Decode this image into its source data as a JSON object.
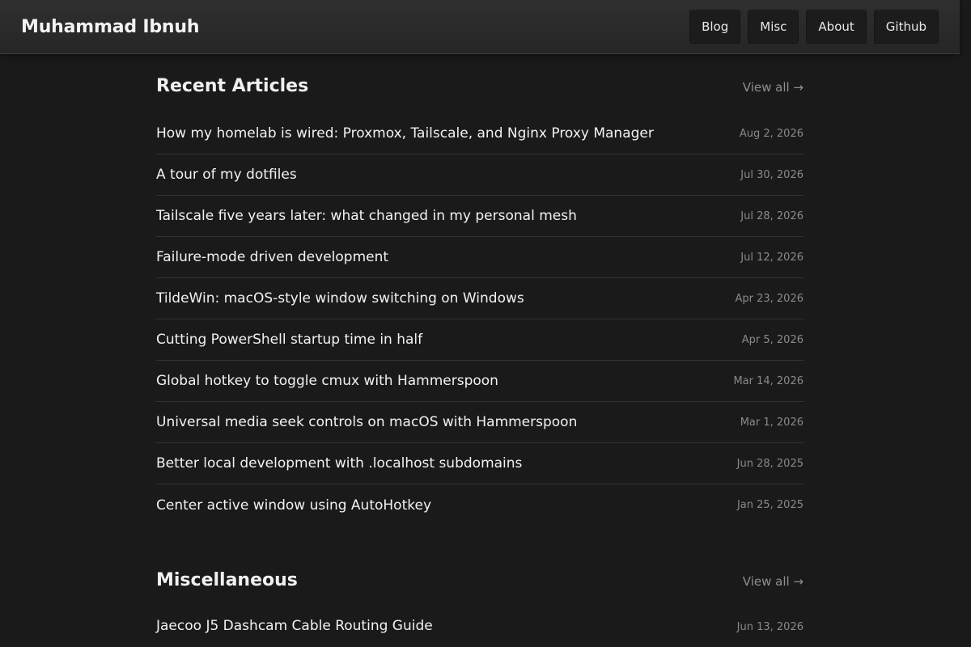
{
  "header": {
    "site_title": "Muhammad Ibnuh",
    "nav": [
      {
        "label": "Blog"
      },
      {
        "label": "Misc"
      },
      {
        "label": "About"
      },
      {
        "label": "Github"
      }
    ]
  },
  "recent": {
    "title": "Recent Articles",
    "view_all": "View all →",
    "articles": [
      {
        "title": "How my homelab is wired: Proxmox, Tailscale, and Nginx Proxy Manager",
        "date": "Aug 2, 2026"
      },
      {
        "title": "A tour of my dotfiles",
        "date": "Jul 30, 2026"
      },
      {
        "title": "Tailscale five years later: what changed in my personal mesh",
        "date": "Jul 28, 2026"
      },
      {
        "title": "Failure-mode driven development",
        "date": "Jul 12, 2026"
      },
      {
        "title": "TildeWin: macOS-style window switching on Windows",
        "date": "Apr 23, 2026"
      },
      {
        "title": "Cutting PowerShell startup time in half",
        "date": "Apr 5, 2026"
      },
      {
        "title": "Global hotkey to toggle cmux with Hammerspoon",
        "date": "Mar 14, 2026"
      },
      {
        "title": "Universal media seek controls on macOS with Hammerspoon",
        "date": "Mar 1, 2026"
      },
      {
        "title": "Better local development with .localhost subdomains",
        "date": "Jun 28, 2025"
      },
      {
        "title": "Center active window using AutoHotkey",
        "date": "Jan 25, 2025"
      }
    ]
  },
  "misc": {
    "title": "Miscellaneous",
    "view_all": "View all →",
    "items": [
      {
        "title": "Jaecoo J5 Dashcam Cable Routing Guide",
        "date": "Jun 13, 2026"
      }
    ]
  }
}
